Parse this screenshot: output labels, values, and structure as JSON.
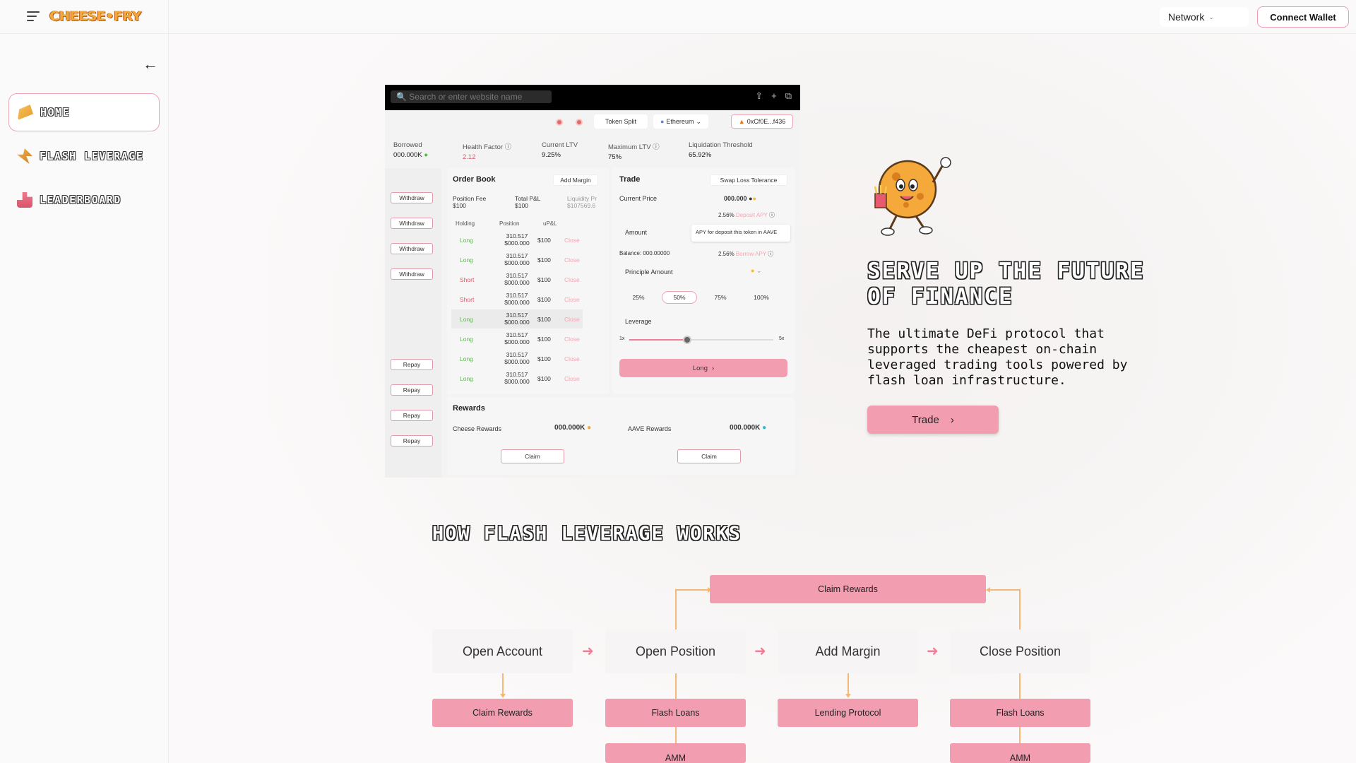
{
  "header": {
    "logo": "CHEESE•FRY",
    "network_label": "Network",
    "connect_label": "Connect Wallet"
  },
  "sidebar": {
    "items": [
      {
        "label": "HOME",
        "icon": "cheese-icon",
        "active": true
      },
      {
        "label": "FLASH LEVERAGE",
        "icon": "flash-icon",
        "active": false
      },
      {
        "label": "LEADERBOARD",
        "icon": "leaderboard-icon",
        "active": false
      }
    ]
  },
  "mock": {
    "search_placeholder": "Search or enter website name",
    "token_split": "Token Split",
    "network": "Ethereum",
    "address": "0xCf0E...f436",
    "stats": [
      {
        "label": "Borrowed",
        "value": "000.000K"
      },
      {
        "label": "Health Factor",
        "value": "2.12"
      },
      {
        "label": "Current LTV",
        "value": "9.25%"
      },
      {
        "label": "Maximum LTV",
        "value": "75%"
      },
      {
        "label": "Liquidation Threshold",
        "value": "65.92%"
      }
    ],
    "withdraw_label": "Withdraw",
    "repay_label": "Repay",
    "order_book": {
      "title": "Order Book",
      "add_margin": "Add Margin",
      "position_fee_label": "Position Fee",
      "position_fee": "$100",
      "total_pl_label": "Total P&L",
      "total_pl": "$100",
      "liquidity_label": "Liquidity Pr",
      "liquidity": "$107569.6",
      "columns": [
        "Holding",
        "Position",
        "uP&L"
      ],
      "rows": [
        {
          "side": "Long",
          "pos1": "310.517",
          "pos2": "$000.000",
          "upl": "$100",
          "action": "Close"
        },
        {
          "side": "Long",
          "pos1": "310.517",
          "pos2": "$000.000",
          "upl": "$100",
          "action": "Close"
        },
        {
          "side": "Short",
          "pos1": "310.517",
          "pos2": "$000.000",
          "upl": "$100",
          "action": "Close"
        },
        {
          "side": "Short",
          "pos1": "310.517",
          "pos2": "$000.000",
          "upl": "$100",
          "action": "Close"
        },
        {
          "side": "Long",
          "pos1": "310.517",
          "pos2": "$000.000",
          "upl": "$100",
          "action": "Close"
        },
        {
          "side": "Long",
          "pos1": "310.517",
          "pos2": "$000.000",
          "upl": "$100",
          "action": "Close"
        },
        {
          "side": "Long",
          "pos1": "310.517",
          "pos2": "$000.000",
          "upl": "$100",
          "action": "Close"
        },
        {
          "side": "Long",
          "pos1": "310.517",
          "pos2": "$000.000",
          "upl": "$100",
          "action": "Close"
        }
      ]
    },
    "trade": {
      "title": "Trade",
      "swap_loss": "Swap Loss Tolerance",
      "current_price_label": "Current Price",
      "current_price": "000.000",
      "deposit_apy": "2.56%",
      "deposit_apy_label": "Deposit APY",
      "amount_label": "Amount",
      "tooltip": "APY for deposit this token in AAVE",
      "balance": "Balance: 000.00000",
      "borrow_apy": "2.56%",
      "borrow_apy_label": "Borrow APY",
      "principle_label": "Principle Amount",
      "percents": [
        "25%",
        "50%",
        "75%",
        "100%"
      ],
      "leverage_label": "Leverage",
      "lev_min": "1x",
      "lev_max": "5x",
      "leverage_value": 0.4,
      "long_btn": "Long"
    },
    "rewards": {
      "title": "Rewards",
      "cheese_label": "Cheese Rewards",
      "cheese_value": "000.000K",
      "aave_label": "AAVE Rewards",
      "aave_value": "000.000K",
      "claim": "Claim"
    }
  },
  "hero": {
    "title": "SERVE UP THE FUTURE OF FINANCE",
    "subtitle": "The ultimate DeFi protocol that supports the cheapest on-chain leveraged trading tools powered by flash loan infrastructure.",
    "trade_label": "Trade"
  },
  "how": {
    "title": "HOW FLASH LEVERAGE WORKS",
    "steps": [
      "Open Account",
      "Open Position",
      "Add Margin",
      "Close Position"
    ],
    "top_box": "Claim Rewards",
    "sub_boxes": [
      "Claim Rewards",
      "Flash Loans",
      "Lending Protocol",
      "Flash Loans"
    ],
    "amm_label": "AMM"
  },
  "colors": {
    "accent_pink": "#f29db0",
    "connector_orange": "#f5b977",
    "long_green": "#5bb74b",
    "short_red": "#e0556a"
  }
}
